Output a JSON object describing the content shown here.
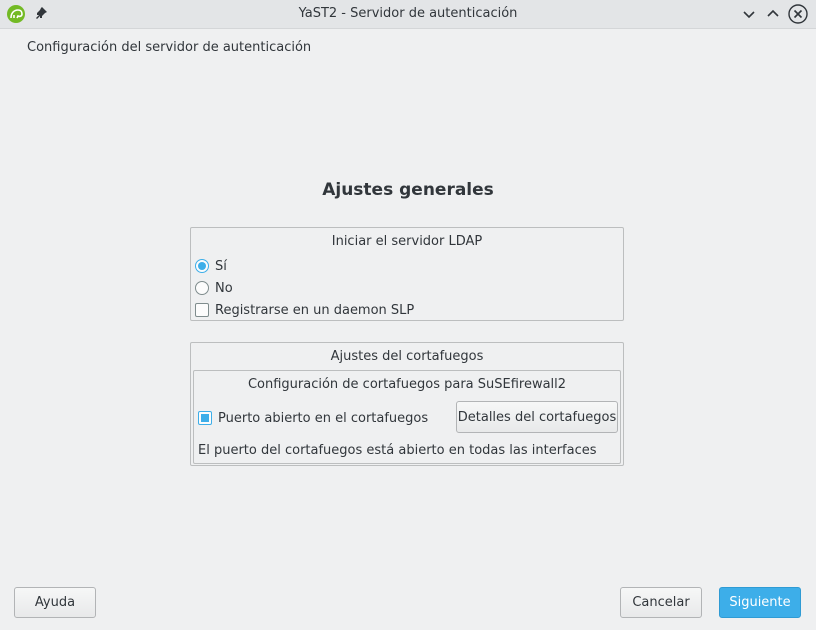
{
  "window": {
    "title": "YaST2 - Servidor de autenticación"
  },
  "page": {
    "subtitle": "Configuración del servidor de autenticación",
    "heading": "Ajustes generales"
  },
  "ldap_group": {
    "title": "Iniciar el servidor LDAP",
    "options": [
      {
        "label": "Sí",
        "selected": true
      },
      {
        "label": "No",
        "selected": false
      }
    ],
    "slp": {
      "label": "Registrarse en un daemon SLP",
      "checked": false
    }
  },
  "firewall_group": {
    "title": "Ajustes del cortafuegos",
    "inner_title": "Configuración de cortafuegos para SuSEfirewall2",
    "open_port": {
      "label": "Puerto abierto en el cortafuegos",
      "checked": true
    },
    "details_button": "Detalles del cortafuegos",
    "status": "El puerto del cortafuegos está abierto en todas las interfaces"
  },
  "footer": {
    "help": "Ayuda",
    "cancel": "Cancelar",
    "next": "Siguiente"
  },
  "colors": {
    "accent": "#3daee9",
    "background": "#eff0f1"
  }
}
